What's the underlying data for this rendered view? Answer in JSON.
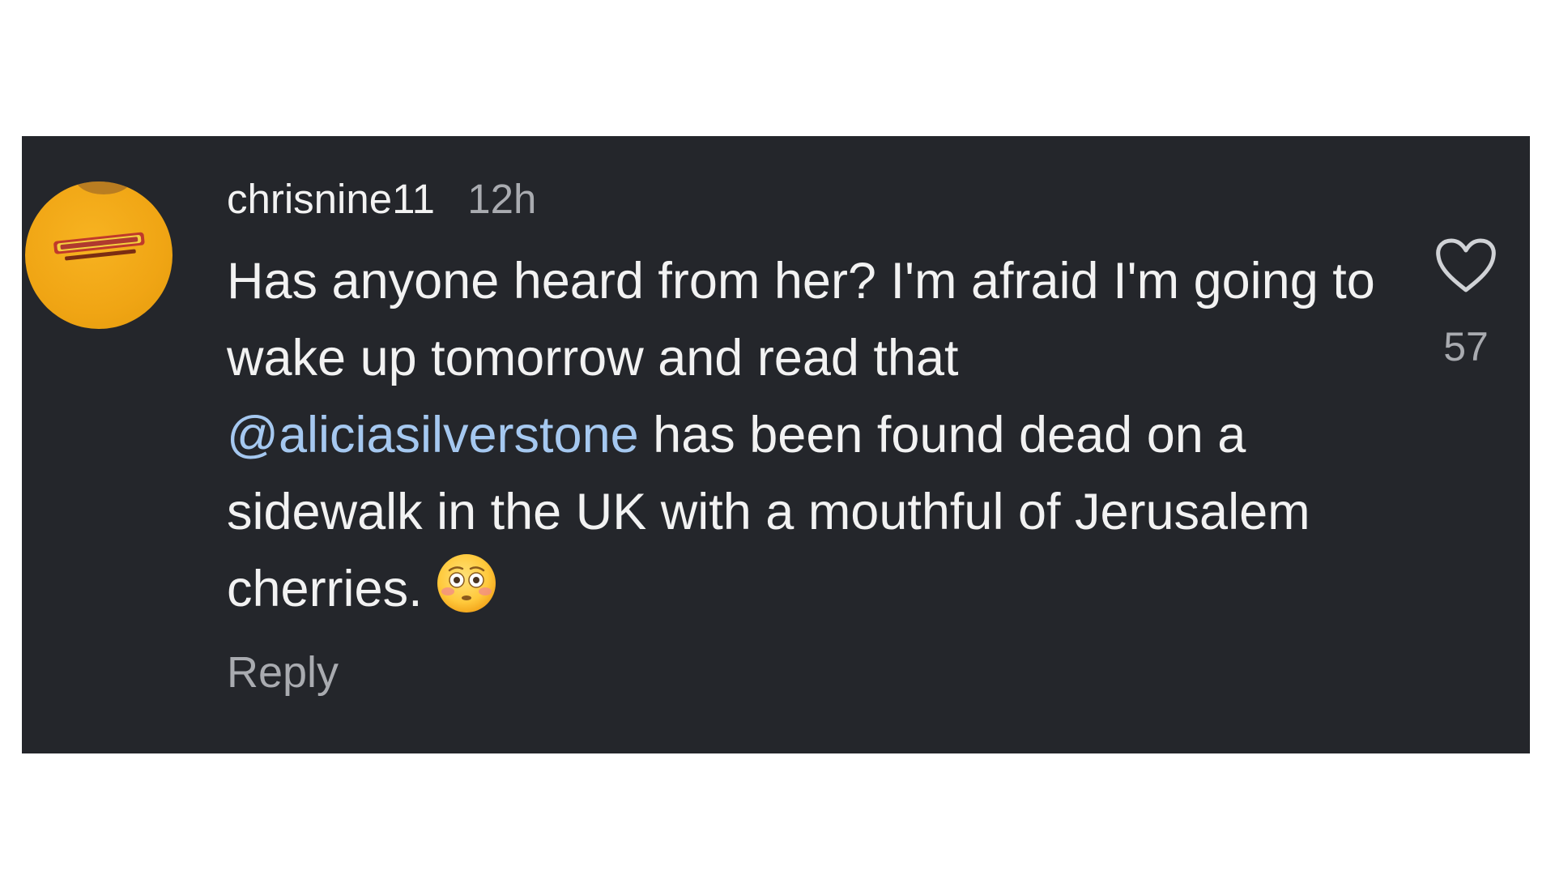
{
  "comment": {
    "username": "chrisnine11",
    "timestamp": "12h",
    "text_before_mention": "Has anyone heard from her? I'm afraid I'm going to wake up tomorrow and read that ",
    "mention": "@aliciasilverstone",
    "text_after_mention": " has been found dead on a sidewalk in the UK with a mouthful of Jerusalem cherries.",
    "emoji": "flushed-face-emoji",
    "reply_label": "Reply",
    "like_count": "57",
    "like_icon": "heart-outline-icon",
    "avatar_icon": "user-avatar"
  },
  "colors": {
    "card_background": "#24262b",
    "page_background": "#ffffff",
    "primary_text": "#f2f2f2",
    "secondary_text": "#a9abb0",
    "mention": "#a5c8f0",
    "avatar": "#f0a514"
  }
}
